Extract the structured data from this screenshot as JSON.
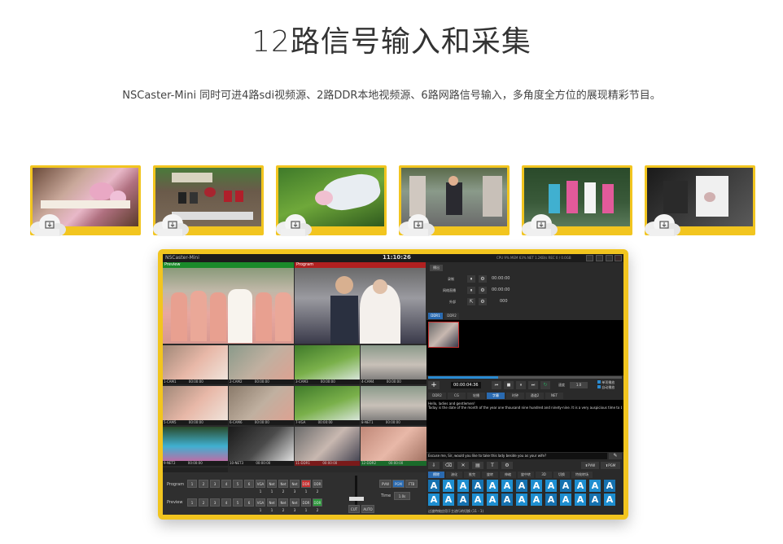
{
  "header": {
    "title": "12路信号输入和采集",
    "subtitle": "NSCaster-Mini 同时可进4路sdi视频源、2路DDR本地视频源、6路网路信号输入，多角度全方位的展现精彩节目。"
  },
  "thumbnails_count": 6,
  "app": {
    "name": "NSCaster-Mini",
    "clock": "11:10:26",
    "stats": "CPU 9%  MEM 63%  NET 1.2KB/s  REC 0 / 0.0GB",
    "preview_label": "Preview",
    "program_label": "Program",
    "cells": [
      {
        "label": "1-CAM1",
        "time": "00:00:00"
      },
      {
        "label": "2-CAM2",
        "time": "00:00:00"
      },
      {
        "label": "3-CAM3",
        "time": "00:00:00"
      },
      {
        "label": "4-CAM4",
        "time": "00:00:00"
      },
      {
        "label": "5-CAM5",
        "time": "00:00:00"
      },
      {
        "label": "6-CAM6",
        "time": "00:00:00"
      },
      {
        "label": "7-VGA",
        "time": "00:00:00"
      },
      {
        "label": "8-NET1",
        "time": "00:00:00"
      },
      {
        "label": "9-NET2",
        "time": "00:00:00"
      },
      {
        "label": "10-NET3",
        "time": "00:00:00"
      },
      {
        "label": "11-DDR1",
        "time": "00:00:00"
      },
      {
        "label": "12-DDR2",
        "time": "00:00:00"
      }
    ],
    "bus": {
      "program_label": "Program",
      "preview_label": "Preview",
      "buttons": [
        "1",
        "2",
        "3",
        "4",
        "5",
        "6",
        "VGA\n1",
        "Net\n1",
        "Net\n2",
        "Net\n3",
        "DDR\n1",
        "DDR\n2"
      ],
      "pvw": "PVW",
      "pgm": "PGM",
      "ftb": "FTB",
      "time_label": "Time",
      "time_value": "1.0s",
      "cut": "CUT",
      "auto": "AUTO"
    },
    "right": {
      "top_tab": "播出",
      "rows": [
        {
          "name": "录制",
          "time": "00:00:00"
        },
        {
          "name": "网络直播",
          "time": "00:00:00"
        },
        {
          "name": "外部",
          "time": "000"
        }
      ],
      "ddr_tabs": [
        "DDR1",
        "DDR2"
      ],
      "playback_time": "00:00:04:36",
      "speed_label": "速度",
      "speed_value": "1.0",
      "check1": "单项播放",
      "check2": "自动播放",
      "subtitle_tabs": [
        "DDR2",
        "CG",
        "轮播",
        "字幕",
        "时钟",
        "通道2",
        "NET"
      ],
      "subtitle_text1": "Hello, ladies and gentlemen!",
      "subtitle_text2": "Today is the date of the month of the year one thousand nine hundred and ninety-nine. It is a very auspicious time to be married at this li...",
      "subtitle_text3": "Excuse me, Sir, would you like to take this lady beside you as your wife?",
      "pvw_btn": "PVW",
      "pgm_btn": "PGM",
      "effect_tabs": [
        "擦除",
        "溶化",
        "推完",
        "旋转",
        "伸缩",
        "旋中转",
        "3D",
        "切换",
        "特效转场"
      ],
      "footer": "过渡特效应用于主进行的切换 (11 - 1)"
    }
  }
}
